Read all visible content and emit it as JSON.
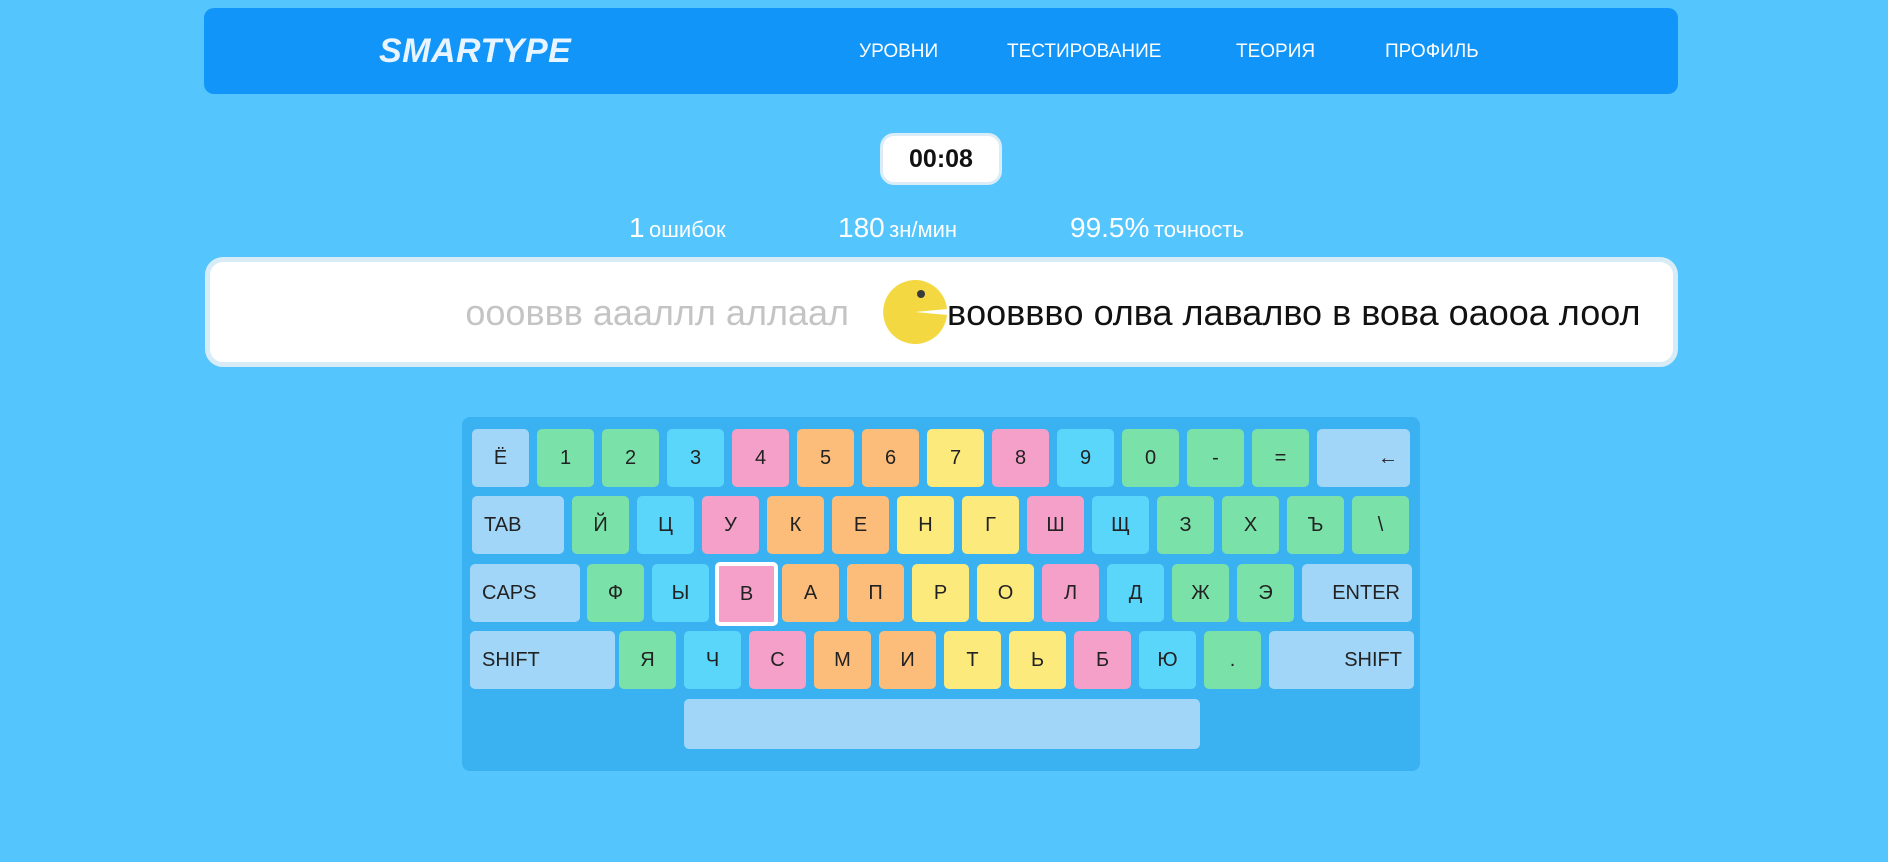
{
  "header": {
    "logo": "SMARTYPE",
    "nav": [
      "УРОВНИ",
      "ТЕСТИРОВАНИЕ",
      "ТЕОРИЯ",
      "ПРОФИЛЬ"
    ]
  },
  "timer": "00:08",
  "stats": [
    {
      "value": "1",
      "label": "ошибок"
    },
    {
      "value": "180",
      "label": "зн/мин"
    },
    {
      "value": "99.5%",
      "label": "точность"
    }
  ],
  "typing": {
    "typed": "oooввв aaaллл аллаал",
    "upcoming": "вooвввo олва лавалво в вова оаооа лоол"
  },
  "keyboard": {
    "rows": [
      [
        {
          "label": "Ё",
          "color": "light"
        },
        {
          "label": "1",
          "color": "green"
        },
        {
          "label": "2",
          "color": "green"
        },
        {
          "label": "3",
          "color": "blue"
        },
        {
          "label": "4",
          "color": "pink"
        },
        {
          "label": "5",
          "color": "orange"
        },
        {
          "label": "6",
          "color": "orange"
        },
        {
          "label": "7",
          "color": "yellow"
        },
        {
          "label": "8",
          "color": "pink"
        },
        {
          "label": "9",
          "color": "blue"
        },
        {
          "label": "0",
          "color": "green"
        },
        {
          "label": "-",
          "color": "green"
        },
        {
          "label": "=",
          "color": "green"
        },
        {
          "label": "←",
          "color": "light"
        }
      ],
      [
        {
          "label": "TAB",
          "color": "light"
        },
        {
          "label": "Й",
          "color": "green"
        },
        {
          "label": "Ц",
          "color": "blue"
        },
        {
          "label": "У",
          "color": "pink"
        },
        {
          "label": "К",
          "color": "orange"
        },
        {
          "label": "Е",
          "color": "orange"
        },
        {
          "label": "Н",
          "color": "yellow"
        },
        {
          "label": "Г",
          "color": "yellow"
        },
        {
          "label": "Ш",
          "color": "pink"
        },
        {
          "label": "Щ",
          "color": "blue"
        },
        {
          "label": "З",
          "color": "green"
        },
        {
          "label": "Х",
          "color": "green"
        },
        {
          "label": "Ъ",
          "color": "green"
        },
        {
          "label": "\\",
          "color": "green"
        }
      ],
      [
        {
          "label": "CAPS",
          "color": "light"
        },
        {
          "label": "Ф",
          "color": "green"
        },
        {
          "label": "Ы",
          "color": "blue"
        },
        {
          "label": "В",
          "color": "pink",
          "active": true
        },
        {
          "label": "А",
          "color": "orange"
        },
        {
          "label": "П",
          "color": "orange"
        },
        {
          "label": "Р",
          "color": "yellow"
        },
        {
          "label": "О",
          "color": "yellow"
        },
        {
          "label": "Л",
          "color": "pink"
        },
        {
          "label": "Д",
          "color": "blue"
        },
        {
          "label": "Ж",
          "color": "green"
        },
        {
          "label": "Э",
          "color": "green"
        },
        {
          "label": "ENTER",
          "color": "light"
        }
      ],
      [
        {
          "label": "SHIFT",
          "color": "light"
        },
        {
          "label": "Я",
          "color": "green"
        },
        {
          "label": "Ч",
          "color": "blue"
        },
        {
          "label": "С",
          "color": "pink"
        },
        {
          "label": "М",
          "color": "orange"
        },
        {
          "label": "И",
          "color": "orange"
        },
        {
          "label": "Т",
          "color": "yellow"
        },
        {
          "label": "Ь",
          "color": "yellow"
        },
        {
          "label": "Б",
          "color": "pink"
        },
        {
          "label": "Ю",
          "color": "blue"
        },
        {
          "label": ".",
          "color": "green"
        },
        {
          "label": "SHIFT",
          "color": "light"
        }
      ],
      [
        {
          "label": "",
          "color": "light"
        }
      ]
    ]
  }
}
